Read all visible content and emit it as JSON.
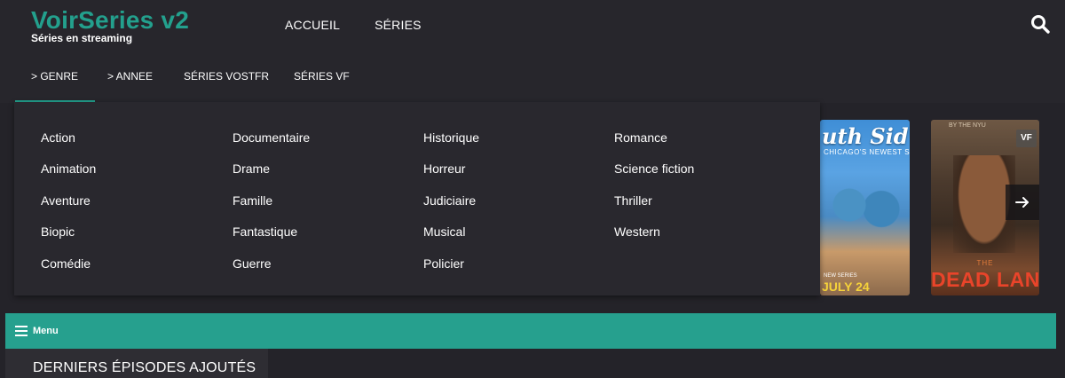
{
  "brand": {
    "title": "VoirSeries v2",
    "subtitle": "Séries en streaming",
    "accent_color": "#23a08d"
  },
  "main_nav": [
    {
      "label": "ACCUEIL"
    },
    {
      "label": "SÉRIES"
    }
  ],
  "search": {
    "icon": "search-icon"
  },
  "sub_nav": [
    {
      "label": "> GENRE",
      "active": true
    },
    {
      "label": "> ANNEE",
      "active": false
    },
    {
      "label": "SÉRIES VOSTFR",
      "active": false
    },
    {
      "label": "SÉRIES VF",
      "active": false
    }
  ],
  "genres": [
    [
      "Action",
      "Animation",
      "Aventure",
      "Biopic",
      "Comédie"
    ],
    [
      "Documentaire",
      "Drame",
      "Famille",
      "Fantastique",
      "Guerre"
    ],
    [
      "Historique",
      "Horreur",
      "Judiciaire",
      "Musical",
      "Policier"
    ],
    [
      "Romance",
      "Science fiction",
      "Thriller",
      "Western"
    ]
  ],
  "carousel": {
    "posters": [
      {
        "title_art": "uth Sid",
        "tagline": "CHICAGO'S NEWEST SIDE HUSTLE",
        "small_text": "NEW SERIES",
        "date_text": "JULY 24"
      },
      {
        "top_text": "BY THE NYU",
        "title_small": "THE",
        "title_art": "DEAD LANDS",
        "badge": "VF"
      }
    ],
    "next_icon": "arrow-right-icon"
  },
  "menu_bar": {
    "label": "Menu",
    "icon": "hamburger-icon",
    "color": "#26a08e"
  },
  "section": {
    "title": "DERNIERS ÉPISODES AJOUTÉS"
  }
}
